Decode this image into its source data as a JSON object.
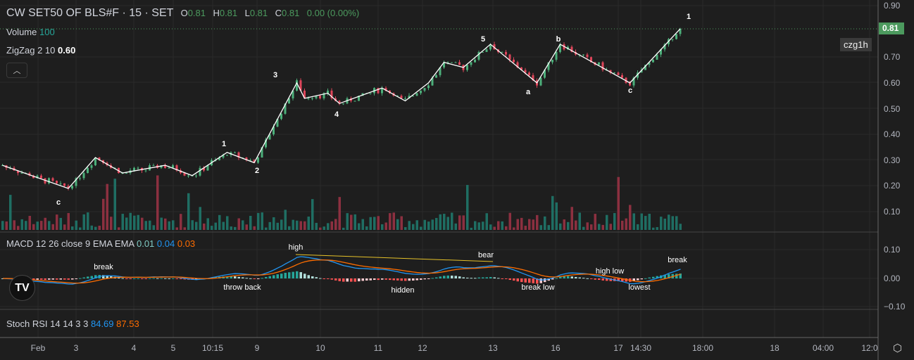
{
  "header": {
    "symbol": "CW SET50 OF BLS#F · 15 · SET",
    "open_label": "O",
    "open": "0.81",
    "high_label": "H",
    "high": "0.81",
    "low_label": "L",
    "low": "0.81",
    "close_label": "C",
    "close": "0.81",
    "change": "0.00 (0.00%)"
  },
  "indicators": {
    "volume": {
      "label": "Volume",
      "value": "100"
    },
    "zigzag": {
      "label": "ZigZag 2 10",
      "value": "0.60"
    },
    "macd": {
      "label": "MACD 12 26 close 9 EMA EMA",
      "hist": "0.01",
      "macd": "0.04",
      "signal": "0.03"
    },
    "stoch": {
      "label": "Stoch RSI 14 14 3 3",
      "k": "84.69",
      "d": "87.53"
    }
  },
  "collapse_icon": "chevron-up-icon",
  "price_axis": [
    "0.90",
    "0.70",
    "0.60",
    "0.50",
    "0.40",
    "0.30",
    "0.20",
    "0.10"
  ],
  "macd_axis": [
    "0.10",
    "0.00",
    "−0.10"
  ],
  "last_price": "0.81",
  "tag": "czg1h",
  "time_axis": [
    "Feb",
    "3",
    "4",
    "5",
    "10:15",
    "9",
    "10",
    "11",
    "12",
    "13",
    "16",
    "17",
    "14:30",
    "18:00",
    "18",
    "04:00",
    "12:0"
  ],
  "zigzag_labels": [
    "c",
    "1",
    "2",
    "3",
    "4",
    "5",
    "a",
    "b",
    "c",
    "1"
  ],
  "macd_annotations": [
    "high",
    "bear",
    "break",
    "throw back",
    "hidden",
    "break low",
    "high low",
    "lowest",
    "break"
  ],
  "colors": {
    "up": "#4caf7a",
    "down": "#e0455a",
    "macd": "#2196f3",
    "signal": "#ff6d00",
    "zigzag": "#ffffff"
  },
  "chart_data": {
    "type": "candlestick",
    "zigzag_pivots": [
      [
        0,
        0.28
      ],
      [
        17,
        0.19
      ],
      [
        24,
        0.31
      ],
      [
        31,
        0.25
      ],
      [
        42,
        0.28
      ],
      [
        49,
        0.24
      ],
      [
        58,
        0.33
      ],
      [
        65,
        0.29
      ],
      [
        76,
        0.6
      ],
      [
        78,
        0.54
      ],
      [
        84,
        0.56
      ],
      [
        87,
        0.52
      ],
      [
        98,
        0.58
      ],
      [
        104,
        0.53
      ],
      [
        110,
        0.6
      ],
      [
        114,
        0.68
      ],
      [
        119,
        0.66
      ],
      [
        126,
        0.75
      ],
      [
        138,
        0.6
      ],
      [
        144,
        0.75
      ],
      [
        162,
        0.6
      ],
      [
        175,
        0.81
      ]
    ]
  }
}
